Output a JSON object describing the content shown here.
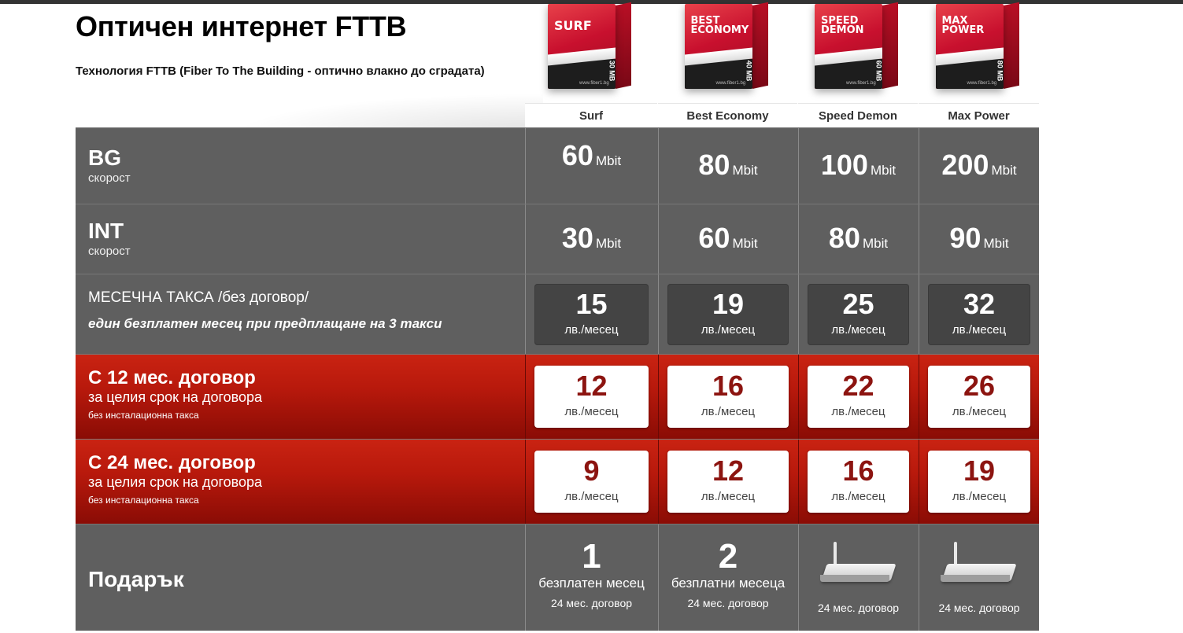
{
  "header": {
    "title": "Оптичен интернет FTTB",
    "subtitle": "Технология FTTB (Fiber To The Building - оптично влакно до сградата)"
  },
  "packages": [
    {
      "box_text": "SURF",
      "box_mb": "30 MB",
      "label": "Surf"
    },
    {
      "box_text": "BEST ECONOMY",
      "box_mb": "40 MB",
      "label": "Best Economy"
    },
    {
      "box_text": "SPEED DEMON",
      "box_mb": "60 MB",
      "label": "Speed Demon"
    },
    {
      "box_text": "MAX POWER",
      "box_mb": "80 MB",
      "label": "Max Power"
    }
  ],
  "box_site": "www.fiber1.bg",
  "rows": {
    "bg": {
      "title": "BG",
      "subtitle": "скорост",
      "values": [
        {
          "num": "60",
          "unit": "Mbit"
        },
        {
          "num": "80",
          "unit": "Mbit"
        },
        {
          "num": "100",
          "unit": "Mbit"
        },
        {
          "num": "200",
          "unit": "Mbit"
        }
      ]
    },
    "int": {
      "title": "INT",
      "subtitle": "скорост",
      "values": [
        {
          "num": "30",
          "unit": "Mbit"
        },
        {
          "num": "60",
          "unit": "Mbit"
        },
        {
          "num": "80",
          "unit": "Mbit"
        },
        {
          "num": "90",
          "unit": "Mbit"
        }
      ]
    },
    "monthly": {
      "title": "МЕСЕЧНА ТАКСА /без договор/",
      "note": "един безплатен месец при предплащане на 3 такси",
      "values": [
        {
          "num": "15",
          "unit": "лв./месец"
        },
        {
          "num": "19",
          "unit": "лв./месец"
        },
        {
          "num": "25",
          "unit": "лв./месец"
        },
        {
          "num": "32",
          "unit": "лв./месец"
        }
      ]
    },
    "c12": {
      "title": "С 12 мес. договор",
      "line2": "за целия срок на договора",
      "line3": "без инсталационна такса",
      "values": [
        {
          "num": "12",
          "unit": "лв./месец"
        },
        {
          "num": "16",
          "unit": "лв./месец"
        },
        {
          "num": "22",
          "unit": "лв./месец"
        },
        {
          "num": "26",
          "unit": "лв./месец"
        }
      ]
    },
    "c24": {
      "title": "С 24 мес. договор",
      "line2": "за целия срок на договора",
      "line3": "без инсталационна такса",
      "values": [
        {
          "num": "9",
          "unit": "лв./месец"
        },
        {
          "num": "12",
          "unit": "лв./месец"
        },
        {
          "num": "16",
          "unit": "лв./месец"
        },
        {
          "num": "19",
          "unit": "лв./месец"
        }
      ]
    },
    "gift": {
      "title": "Подарък",
      "values": [
        {
          "num": "1",
          "text": "безплатен месец",
          "note": "24 мес. договор"
        },
        {
          "num": "2",
          "text": "безплатни месеца",
          "note": "24 мес. договор"
        },
        {
          "icon": "router-icon",
          "note": "24 мес. договор"
        },
        {
          "icon": "router-icon",
          "note": "24 мес. договор"
        }
      ]
    }
  }
}
